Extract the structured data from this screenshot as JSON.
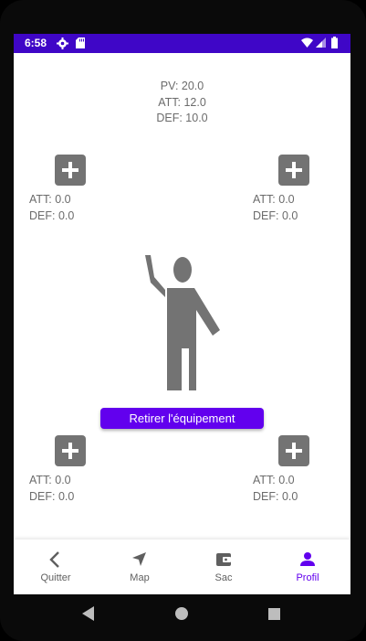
{
  "status_bar": {
    "time": "6:58"
  },
  "stats": {
    "pv": "PV: 20.0",
    "att": "ATT: 12.0",
    "def": "DEF: 10.0"
  },
  "slots": [
    {
      "att": "ATT: 0.0",
      "def": "DEF: 0.0"
    },
    {
      "att": "ATT: 0.0",
      "def": "DEF: 0.0"
    },
    {
      "att": "ATT: 0.0",
      "def": "DEF: 0.0"
    },
    {
      "att": "ATT: 0.0",
      "def": "DEF: 0.0"
    }
  ],
  "remove_button": "Retirer l'équipement",
  "bottom_nav": [
    {
      "label": "Quitter",
      "icon": "chevron-left-icon"
    },
    {
      "label": "Map",
      "icon": "navigation-arrow-icon"
    },
    {
      "label": "Sac",
      "icon": "wallet-icon"
    },
    {
      "label": "Profil",
      "icon": "person-icon",
      "active": true
    }
  ],
  "colors": {
    "status_bar": "#3f06c7",
    "accent": "#6200ee",
    "icon_gray": "#737373",
    "text_gray": "#6b6b6b"
  }
}
